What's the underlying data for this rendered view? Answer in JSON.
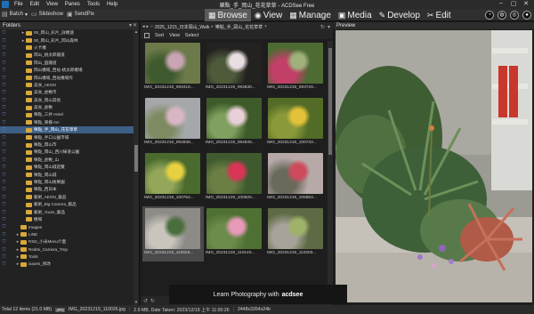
{
  "app": {
    "title": "樂點_手_岡山_花花草草 - ACDSee Free",
    "menu": [
      "File",
      "Edit",
      "View",
      "Panes",
      "Tools",
      "Help"
    ],
    "window_buttons": [
      "–",
      "▢",
      "✕"
    ]
  },
  "toolbar": {
    "batch_label": "Batch",
    "slideshow_label": "Slideshow",
    "sendpix_label": "SendPix"
  },
  "modes": [
    {
      "label": "Browse",
      "icon": "folder-icon",
      "active": true
    },
    {
      "label": "View",
      "icon": "eye-icon",
      "active": false
    },
    {
      "label": "Manage",
      "icon": "grid-icon",
      "active": false
    },
    {
      "label": "Media",
      "icon": "media-icon",
      "active": false
    },
    {
      "label": "Develop",
      "icon": "develop-icon",
      "active": false
    },
    {
      "label": "Edit",
      "icon": "edit-icon",
      "active": false
    }
  ],
  "folders_panel": {
    "title": "Folders",
    "items": [
      {
        "label": "00_岡山_彩片_詳機遠",
        "indent": 1,
        "arrow": "▸"
      },
      {
        "label": "00_岡山_彩片_岡山森林",
        "indent": 1,
        "arrow": "▸"
      },
      {
        "label": "火卡機",
        "indent": 1,
        "arrow": ""
      },
      {
        "label": "岡山_桃太郎鐵道",
        "indent": 1,
        "arrow": ""
      },
      {
        "label": "岡山_圓鐵道",
        "indent": 1,
        "arrow": ""
      },
      {
        "label": "岡山機場_西站-桃太郎機場",
        "indent": 1,
        "arrow": ""
      },
      {
        "label": "岡山機場_西站機場作",
        "indent": 1,
        "arrow": ""
      },
      {
        "label": "美食_AEON",
        "indent": 1,
        "arrow": ""
      },
      {
        "label": "美食_倉敷市",
        "indent": 1,
        "arrow": ""
      },
      {
        "label": "美食_岡山其他",
        "indent": 1,
        "arrow": ""
      },
      {
        "label": "美食_倉敷",
        "indent": 1,
        "arrow": ""
      },
      {
        "label": "樂點_三井 Hotel",
        "indent": 1,
        "arrow": ""
      },
      {
        "label": "樂點_東橫 Inn",
        "indent": 1,
        "arrow": ""
      },
      {
        "label": "樂點_手_岡山_花花草草",
        "indent": 1,
        "arrow": "",
        "selected": true
      },
      {
        "label": "樂點_手口公園市場",
        "indent": 1,
        "arrow": ""
      },
      {
        "label": "樂點_岡山市",
        "indent": 1,
        "arrow": ""
      },
      {
        "label": "樂點_岡山_西川綠道公園",
        "indent": 1,
        "arrow": ""
      },
      {
        "label": "樂點_倉敷_山",
        "indent": 1,
        "arrow": ""
      },
      {
        "label": "樂點_岡山城遊覽",
        "indent": 1,
        "arrow": ""
      },
      {
        "label": "樂點_岡山城",
        "indent": 1,
        "arrow": ""
      },
      {
        "label": "樂點_岡山後樂園",
        "indent": 1,
        "arrow": ""
      },
      {
        "label": "樂點_西日本",
        "indent": 1,
        "arrow": ""
      },
      {
        "label": "藝術_AEON_藝品",
        "indent": 1,
        "arrow": ""
      },
      {
        "label": "藝術_Big Camera_藝品",
        "indent": 1,
        "arrow": ""
      },
      {
        "label": "藝術_Yours_藝品",
        "indent": 1,
        "arrow": ""
      },
      {
        "label": "機場",
        "indent": 1,
        "arrow": ""
      },
      {
        "label": "Images",
        "indent": 0,
        "arrow": ""
      },
      {
        "label": "LINE",
        "indent": 0,
        "arrow": "▸"
      },
      {
        "label": "RSD_小米Menu介面",
        "indent": 0,
        "arrow": "▸"
      },
      {
        "label": "Redmi_Camera_Tmp",
        "indent": 0,
        "arrow": "▸"
      },
      {
        "label": "Tools",
        "indent": 0,
        "arrow": "▸"
      },
      {
        "label": "xiaomi_修改",
        "indent": 0,
        "arrow": "▸"
      }
    ]
  },
  "browser": {
    "breadcrumb": [
      "2025_1215_日本岡山_Walk",
      "樂點_手_岡山_花花草草"
    ],
    "sort_label": "Sort",
    "view_label": "View",
    "select_label": "Select",
    "thumbnails": [
      {
        "name": "IMG_20231219_093416...",
        "colors": [
          "#6c7a4a",
          "#c8a4b4",
          "#3f5a2e"
        ]
      },
      {
        "name": "IMG_20231219_093630...",
        "colors": [
          "#242220",
          "#e8dde0",
          "#4f5a3a"
        ]
      },
      {
        "name": "IMG_20231219_093729...",
        "colors": [
          "#4e6b34",
          "#9fb07a",
          "#c23f68"
        ]
      },
      {
        "name": "IMG_20231219_094938...",
        "colors": [
          "#a5a8aa",
          "#d9b6c5",
          "#7e8a62"
        ]
      },
      {
        "name": "IMG_20231219_094945...",
        "colors": [
          "#3e5c2a",
          "#e9cfd7",
          "#80a060"
        ]
      },
      {
        "name": "IMG_20231219_100733...",
        "colors": [
          "#526b26",
          "#e3c23a",
          "#8a9a38"
        ]
      },
      {
        "name": "IMG_20231219_100752...",
        "colors": [
          "#4a6a2e",
          "#e8d140",
          "#93a65a"
        ]
      },
      {
        "name": "IMG_20231219_100826...",
        "colors": [
          "#3f5a2f",
          "#d83556",
          "#6b7f45"
        ]
      },
      {
        "name": "IMG_20231219_105853...",
        "colors": [
          "#b7a9a8",
          "#cd4a5c",
          "#6a6a5c"
        ]
      },
      {
        "name": "IMG_20231219_110026...",
        "colors": [
          "#8d8b86",
          "#4b6e3d",
          "#c9c5bd"
        ]
      },
      {
        "name": "IMG_20231219_110140...",
        "colors": [
          "#4e7032",
          "#e69ab8",
          "#6b8c4a"
        ]
      },
      {
        "name": "IMG_20231219_110200...",
        "colors": [
          "#5e6a43",
          "#9fb26a",
          "#a7a39a"
        ]
      }
    ],
    "selected_index": 9
  },
  "preview": {
    "title": "Preview"
  },
  "ad": {
    "text": "Learn Photography with",
    "brand": "acdsee"
  },
  "status": {
    "total": "Total 12 items  (21.0 MB)",
    "badge": "JPG",
    "file": "IMG_20231219_110026.jpg",
    "size": "2.9 MB, Date Taken: 2023/12/19 上午 11:00:26",
    "dims": "2448x3264x24b"
  }
}
